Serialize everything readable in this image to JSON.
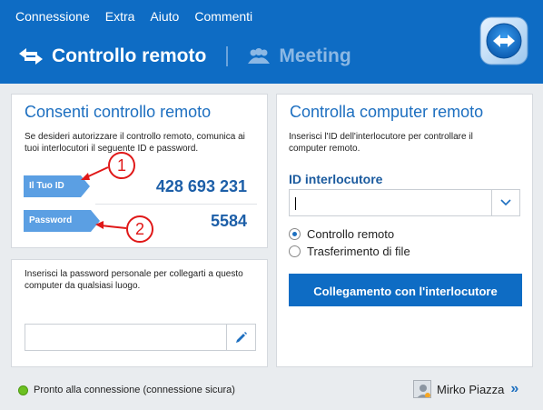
{
  "menu": {
    "items": [
      "Connessione",
      "Extra",
      "Aiuto",
      "Commenti"
    ]
  },
  "tabs": {
    "remote_control": "Controllo remoto",
    "meeting": "Meeting"
  },
  "allow_panel": {
    "title": "Consenti controllo remoto",
    "description": "Se desideri autorizzare il controllo remoto, comunica ai tuoi interlocutori il seguente ID e password.",
    "id_label": "Il Tuo ID",
    "id_value": "428 693 231",
    "password_label": "Password",
    "password_value": "5584"
  },
  "annotations": {
    "marker_1": "1",
    "marker_2": "2"
  },
  "personal_password_panel": {
    "description": "Inserisci la password personale per collegarti a questo computer da qualsiasi luogo.",
    "input_value": ""
  },
  "control_panel": {
    "title": "Controlla computer remoto",
    "description": "Inserisci l'ID dell'interlocutore per controllare il computer remoto.",
    "partner_id_label": "ID interlocutore",
    "partner_id_value": "",
    "options": [
      "Controllo remoto",
      "Trasferimento di file"
    ],
    "selected_option": "Controllo remoto",
    "connect_button": "Collegamento con l'interlocutore"
  },
  "status_bar": {
    "status_text": "Pronto alla connessione (connessione sicura)",
    "status_color": "#6cc021",
    "user_name": "Mirko Piazza"
  },
  "colors": {
    "brand_blue": "#0e6cc4",
    "accent_blue": "#5b9fe3",
    "annotation_red": "#e01818"
  }
}
